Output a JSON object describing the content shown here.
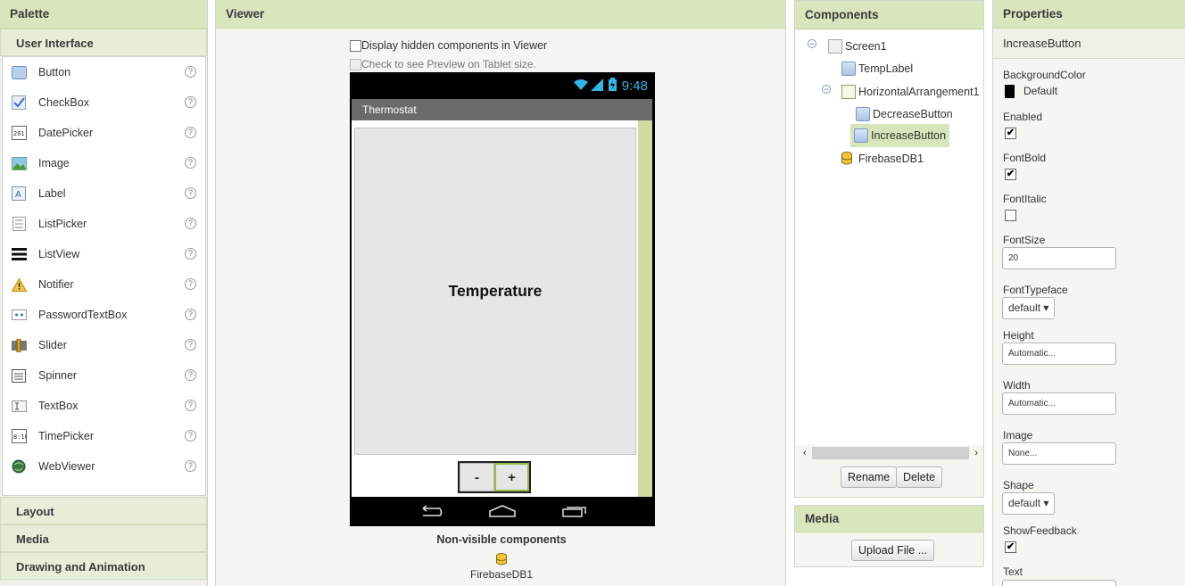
{
  "palette": {
    "title": "Palette",
    "open_category": "User Interface",
    "items": [
      {
        "label": "Button",
        "icon": "button-icon"
      },
      {
        "label": "CheckBox",
        "icon": "checkbox-icon"
      },
      {
        "label": "DatePicker",
        "icon": "datepicker-icon"
      },
      {
        "label": "Image",
        "icon": "image-icon"
      },
      {
        "label": "Label",
        "icon": "label-icon"
      },
      {
        "label": "ListPicker",
        "icon": "listpicker-icon"
      },
      {
        "label": "ListView",
        "icon": "listview-icon"
      },
      {
        "label": "Notifier",
        "icon": "notifier-icon"
      },
      {
        "label": "PasswordTextBox",
        "icon": "password-icon"
      },
      {
        "label": "Slider",
        "icon": "slider-icon"
      },
      {
        "label": "Spinner",
        "icon": "spinner-icon"
      },
      {
        "label": "TextBox",
        "icon": "textbox-icon"
      },
      {
        "label": "TimePicker",
        "icon": "timepicker-icon"
      },
      {
        "label": "WebViewer",
        "icon": "webviewer-icon"
      }
    ],
    "help_glyph": "?",
    "categories": [
      "Layout",
      "Media",
      "Drawing and Animation"
    ]
  },
  "viewer": {
    "title": "Viewer",
    "show_hidden_label": "Display hidden components in Viewer",
    "tablet_preview_label": "Check to see Preview on Tablet size.",
    "phone": {
      "time": "9:48",
      "app_title": "Thermostat",
      "temp_label": "Temperature",
      "decrease_label": "-",
      "increase_label": "+"
    },
    "nonvisible_title": "Non-visible components",
    "nonvisible_items": [
      "FirebaseDB1"
    ]
  },
  "components": {
    "title": "Components",
    "tree": {
      "screen": "Screen1",
      "temp_label": "TempLabel",
      "arrangement": "HorizontalArrangement1",
      "decrease": "DecreaseButton",
      "increase": "IncreaseButton",
      "firebase": "FirebaseDB1"
    },
    "toggle_glyph": "−",
    "rename_label": "Rename",
    "delete_label": "Delete"
  },
  "media": {
    "title": "Media",
    "upload_label": "Upload File ..."
  },
  "properties": {
    "title": "Properties",
    "selected": "IncreaseButton",
    "background_color_label": "BackgroundColor",
    "background_color_value": "Default",
    "background_color_hex": "#000000",
    "enabled_label": "Enabled",
    "enabled_checked": true,
    "fontbold_label": "FontBold",
    "fontbold_checked": true,
    "fontitalic_label": "FontItalic",
    "fontitalic_checked": false,
    "fontsize_label": "FontSize",
    "fontsize_value": "20",
    "fonttypeface_label": "FontTypeface",
    "fonttypeface_value": "default ▾",
    "height_label": "Height",
    "height_value": "Automatic...",
    "width_label": "Width",
    "width_value": "Automatic...",
    "image_label": "Image",
    "image_value": "None...",
    "shape_label": "Shape",
    "shape_value": "default ▾",
    "showfeedback_label": "ShowFeedback",
    "showfeedback_checked": true,
    "text_label": "Text",
    "check_glyph": "✔"
  },
  "colors": {
    "header_bg": "#d9e6bd",
    "selection": "#d8e5b8",
    "scroll_accent": "#cfdc9f",
    "selected_button_border": "#97b94a"
  }
}
